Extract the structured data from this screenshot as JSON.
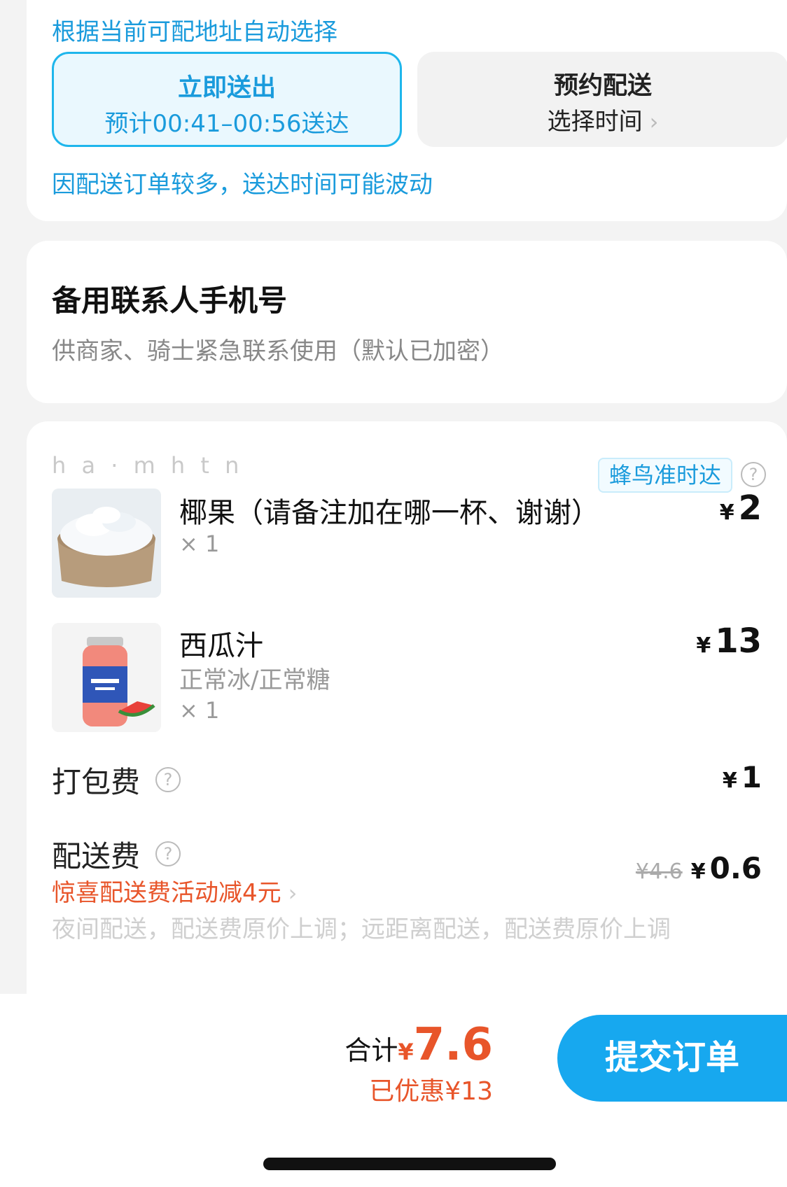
{
  "delivery": {
    "auto_select_note": "根据当前可配地址自动选择",
    "immediate": {
      "title": "立即送出",
      "eta": "预计00:41–00:56送达"
    },
    "scheduled": {
      "title": "预约配送",
      "action": "选择时间"
    },
    "notice": "因配送订单较多，送达时间可能波动"
  },
  "backup_contact": {
    "title": "备用联系人手机号",
    "subtitle": "供商家、骑士紧急联系使用（默认已加密）"
  },
  "order": {
    "shop_name_faded": "h   a   ·   m   h   t   n",
    "badge": "蜂鸟准时达",
    "items": [
      {
        "name": "椰果（请备注加在哪一杯、谢谢）",
        "spec": "",
        "qty": "× 1",
        "currency": "¥",
        "price": "2",
        "thumb": "coconut-jelly-bowl"
      },
      {
        "name": "西瓜汁",
        "spec": "正常冰/正常糖",
        "qty": "× 1",
        "currency": "¥",
        "price": "13",
        "thumb": "watermelon-juice-bottle"
      }
    ],
    "packaging_fee": {
      "label": "打包费",
      "currency": "¥",
      "amount": "1"
    },
    "delivery_fee": {
      "label": "配送费",
      "promo": "惊喜配送费活动减4元",
      "original": "¥4.6",
      "currency": "¥",
      "amount": "0.6",
      "note_faded": "夜间配送，配送费原价上调；远距离配送，配送费原价上调"
    }
  },
  "footer": {
    "total_label": "合计",
    "currency": "¥",
    "total": "7.6",
    "saved": "已优惠¥13",
    "submit_label": "提交订单"
  }
}
